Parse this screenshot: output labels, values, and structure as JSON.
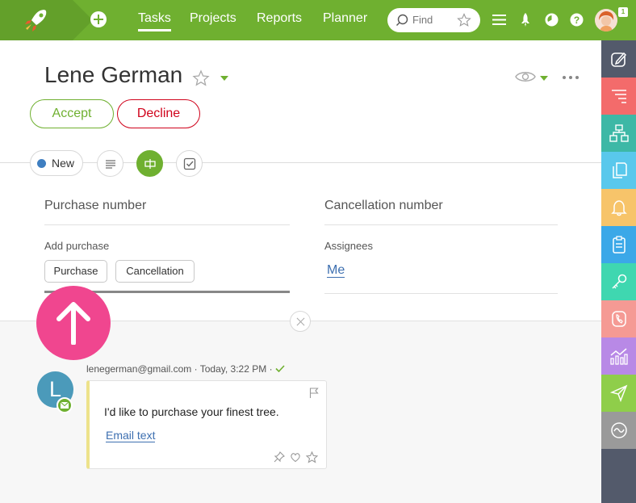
{
  "nav": {
    "items": [
      {
        "label": "Tasks",
        "active": true
      },
      {
        "label": "Projects",
        "active": false
      },
      {
        "label": "Reports",
        "active": false
      },
      {
        "label": "Planner",
        "active": false
      }
    ],
    "search_placeholder": "Find",
    "notification_count": "1"
  },
  "header": {
    "title": "Lene German",
    "accept_label": "Accept",
    "decline_label": "Decline"
  },
  "status": {
    "label": "New",
    "color": "#3f7fc1"
  },
  "fields": {
    "purchase_number_label": "Purchase number",
    "cancellation_number_label": "Cancellation number",
    "add_purchase_label": "Add purchase",
    "chips": [
      "Purchase",
      "Cancellation"
    ],
    "assignees_label": "Assignees",
    "assignee_value": "Me"
  },
  "message": {
    "avatar_letter": "L",
    "sender": "lenegerman@gmail.com",
    "time": "Today, 3:22 PM",
    "body": "I'd like to purchase your finest tree.",
    "link_label": "Email text"
  },
  "sidebar": {
    "items": [
      {
        "icon": "edit-icon",
        "color": "#535a6b"
      },
      {
        "icon": "list-icon",
        "color": "#f36b6b"
      },
      {
        "icon": "structure-icon",
        "color": "#3db8a6"
      },
      {
        "icon": "documents-icon",
        "color": "#59c8ec"
      },
      {
        "icon": "bell-icon",
        "color": "#f7c46a"
      },
      {
        "icon": "clipboard-icon",
        "color": "#3ba8e8"
      },
      {
        "icon": "key-icon",
        "color": "#3fd7b0"
      },
      {
        "icon": "phone-icon",
        "color": "#f59a94"
      },
      {
        "icon": "chart-icon",
        "color": "#b889e6"
      },
      {
        "icon": "send-icon",
        "color": "#8fce4a"
      },
      {
        "icon": "wave-icon",
        "color": "#9a9a9a"
      }
    ]
  },
  "colors": {
    "brand_green": "#6fb030",
    "decline_red": "#d0021b",
    "scroll_up_pink": "#f0468f"
  }
}
